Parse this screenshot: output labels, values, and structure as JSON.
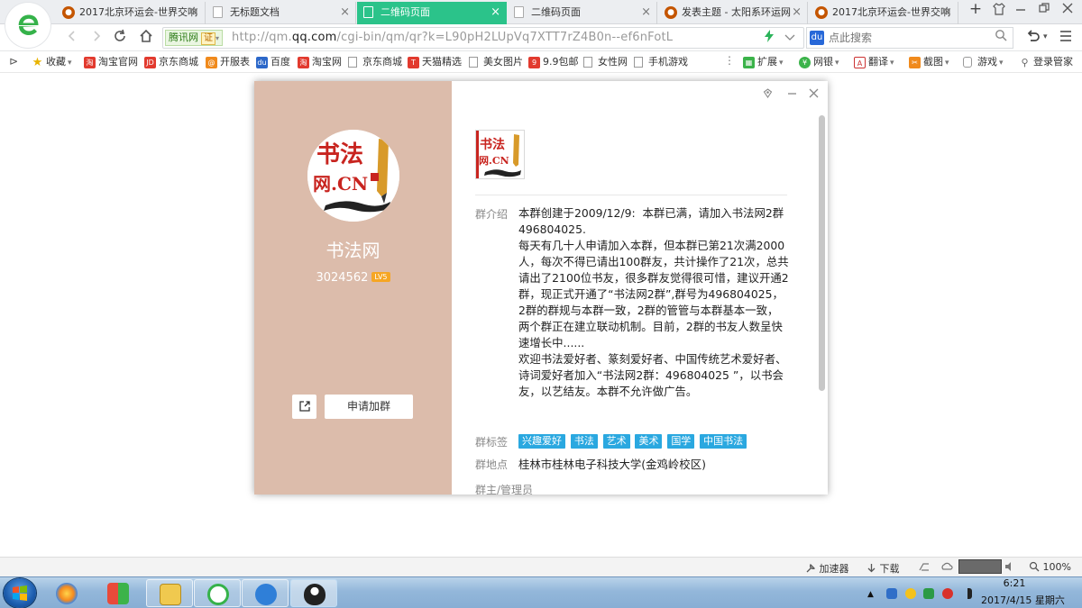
{
  "browser": {
    "tabs": [
      {
        "label": "2017北京环运会-世界交响",
        "icon": "weibo-icon",
        "active": false
      },
      {
        "label": "无标题文档",
        "icon": "document-icon",
        "active": false
      },
      {
        "label": "二维码页面",
        "icon": "document-icon",
        "active": true
      },
      {
        "label": "二维码页面",
        "icon": "document-icon",
        "active": false
      },
      {
        "label": "发表主题 - 太阳系环运网",
        "icon": "weibo-icon",
        "active": false
      },
      {
        "label": "2017北京环运会-世界交响",
        "icon": "weibo-icon",
        "active": false
      }
    ],
    "tab_close_glyph": "×",
    "new_tab_glyph": "+",
    "site_badge": "腾讯网",
    "cert_label": "证",
    "url_prefix": "http://qm.",
    "url_domain": "qq.com",
    "url_rest": "/cgi-bin/qm/qr?k=L90pH2LUpVq7XTT7rZ4B0n--ef6nFotL",
    "search_placeholder": "点此搜索",
    "accent_color": "#2bc38a"
  },
  "bookmarks": {
    "items": [
      {
        "label": "收藏",
        "icon": "star-icon"
      },
      {
        "label": "淘宝官网",
        "icon": "taobao-icon"
      },
      {
        "label": "京东商城",
        "icon": "jd-icon"
      },
      {
        "label": "开服表",
        "icon": "game-icon"
      },
      {
        "label": "百度",
        "icon": "baidu-icon"
      },
      {
        "label": "淘宝网",
        "icon": "taobao-icon"
      },
      {
        "label": "京东商城",
        "icon": "page-icon"
      },
      {
        "label": "天猫精选",
        "icon": "tmall-icon"
      },
      {
        "label": "美女图片",
        "icon": "page-icon"
      },
      {
        "label": "9.9包邮",
        "icon": "deal-icon"
      },
      {
        "label": "女性网",
        "icon": "page-icon"
      },
      {
        "label": "手机游戏",
        "icon": "page-icon"
      }
    ],
    "tools": [
      {
        "label": "扩展",
        "icon": "grid-icon"
      },
      {
        "label": "网银",
        "icon": "bank-icon"
      },
      {
        "label": "翻译",
        "icon": "translate-icon"
      },
      {
        "label": "截图",
        "icon": "screenshot-icon"
      },
      {
        "label": "游戏",
        "icon": "gamepad-icon"
      },
      {
        "label": "登录管家",
        "icon": "login-icon"
      }
    ]
  },
  "group": {
    "name": "书法网",
    "id": "3024562",
    "level": "LV5",
    "logo_line1": "书法",
    "logo_line2": "网.CN",
    "join_label": "申请加群",
    "intro_label": "群介绍",
    "intro_paragraphs": [
      "本群创建于2009/12/9:  本群已满，请加入书法网2群496804025.",
      "每天有几十人申请加入本群，但本群已第21次满2000人，每次不得已请出100群友，共计操作了21次，总共请出了2100位书友，很多群友觉得很可惜，建议开通2群，现正式开通了“书法网2群”,群号为496804025，2群的群规与本群一致，2群的管管与本群基本一致，两个群正在建立联动机制。目前，2群的书友人数呈快速增长中......",
      "欢迎书法爱好者、篆刻爱好者、中国传统艺术爱好者、诗词爱好者加入“书法网2群：496804025 ”，以书会友，以艺结友。本群不允许做广告。"
    ],
    "tags_label": "群标签",
    "tags": [
      "兴趣爱好",
      "书法",
      "艺术",
      "美术",
      "国学",
      "中国书法"
    ],
    "location_label": "群地点",
    "location": "桂林市桂林电子科技大学(金鸡岭校区)",
    "admins_label": "群主/管理员",
    "left_bg_color": "#dcbcab",
    "tag_color": "#2aa8e0"
  },
  "statusbar": {
    "accelerator": "加速器",
    "download": "下载",
    "zoom": "100%"
  },
  "taskbar": {
    "time": "6:21",
    "date": "2017/4/15 星期六"
  }
}
